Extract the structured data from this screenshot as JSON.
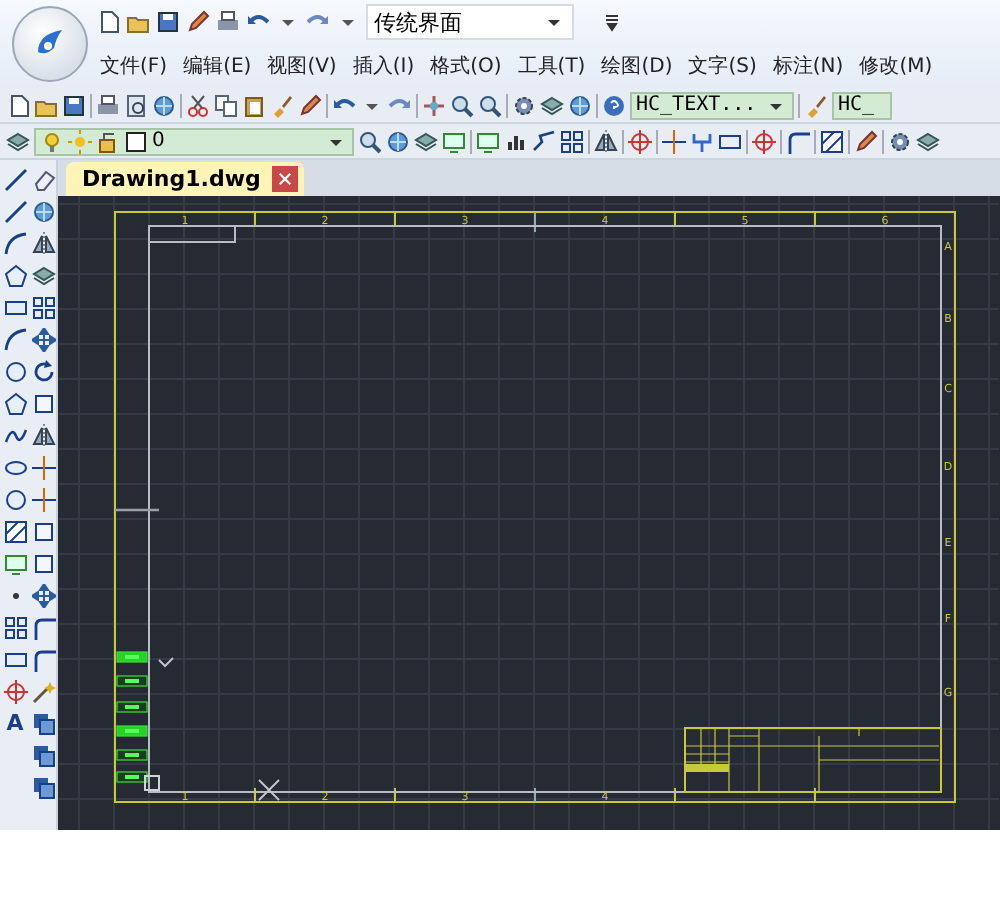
{
  "workspace_combo": {
    "value": "传统界面"
  },
  "menu": [
    "文件(F)",
    "编辑(E)",
    "视图(V)",
    "插入(I)",
    "格式(O)",
    "工具(T)",
    "绘图(D)",
    "文字(S)",
    "标注(N)",
    "修改(M)"
  ],
  "toolbar": {
    "text_style": "HC_TEXT...",
    "dim_style": "HC_"
  },
  "layer_combo": {
    "value": "0"
  },
  "palette": {
    "text_tool_glyph": "A"
  },
  "tabs": [
    {
      "label": "Drawing1.dwg",
      "selected": true
    }
  ],
  "drawing": {
    "top_zones": [
      "1",
      "2",
      "3",
      "4",
      "5",
      "6"
    ],
    "side_zones": [
      "A",
      "B",
      "C",
      "D",
      "E",
      "F",
      "G"
    ],
    "bottom_zones": [
      "1",
      "2",
      "3",
      "4"
    ]
  }
}
